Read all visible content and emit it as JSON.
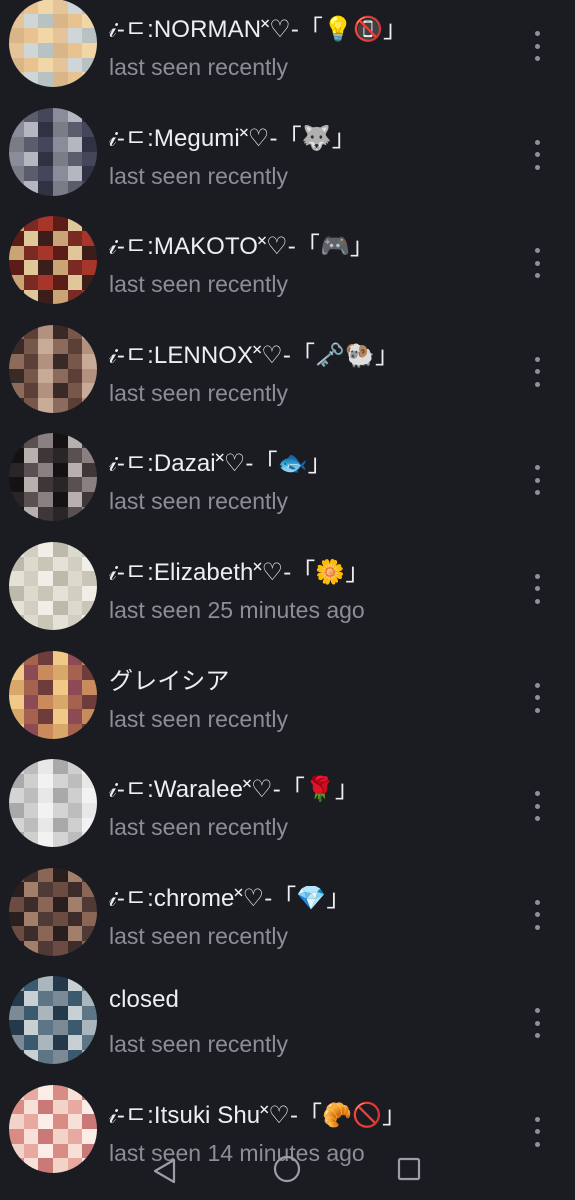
{
  "contacts": [
    {
      "name": "𝒾-ㄷ:NORMAN˟♡-「💡📵」",
      "status": "last seen recently",
      "avatar_colors": [
        "#d9b58a",
        "#e8c38f",
        "#f1d6a8",
        "#e6c49a",
        "#cfd6d8",
        "#b9c2c3"
      ]
    },
    {
      "name": "𝒾-ㄷ:Megumi˟♡-「🐺」",
      "status": "last seen recently",
      "avatar_colors": [
        "#7a7c86",
        "#5a5d6c",
        "#44475a",
        "#8a8c99",
        "#b4b6c0",
        "#2f3242"
      ]
    },
    {
      "name": "𝒾-ㄷ:MAKOTO˟♡-「🎮」",
      "status": "last seen recently",
      "avatar_colors": [
        "#c9a575",
        "#7a2a22",
        "#a6352a",
        "#5c1c18",
        "#e0c79a",
        "#3b1d1a"
      ]
    },
    {
      "name": "𝒾-ㄷ:LENNOX˟♡-「🗝️🐏」",
      "status": "last seen recently",
      "avatar_colors": [
        "#8c6b5d",
        "#5c4038",
        "#b2917f",
        "#3a2a27",
        "#76574a",
        "#c7ab98"
      ]
    },
    {
      "name": "𝒾-ㄷ:Dazai˟♡-「🐟」",
      "status": "last seen recently",
      "avatar_colors": [
        "#2a2627",
        "#5a5052",
        "#8a8081",
        "#141213",
        "#b8b0ae",
        "#3e3637"
      ]
    },
    {
      "name": "𝒾-ㄷ:Elizabeth˟♡-「🌼」",
      "status": "last seen 25 minutes ago",
      "avatar_colors": [
        "#e4e1d6",
        "#d2cfc2",
        "#f0eee6",
        "#bdb9ab",
        "#dcd9cd",
        "#c9c5b7"
      ]
    },
    {
      "name": "グレイシア",
      "status": "last seen recently",
      "avatar_colors": [
        "#d8a76a",
        "#a5624e",
        "#6e3c3a",
        "#f0c987",
        "#8c4a54",
        "#c98b5c"
      ]
    },
    {
      "name": "𝒾-ㄷ:Waralee˟♡-「🌹」",
      "status": "last seen recently",
      "avatar_colors": [
        "#d4d4d4",
        "#bdbdbd",
        "#e8e8e8",
        "#a9a9a9",
        "#cfcfcf",
        "#f2f2f2"
      ]
    },
    {
      "name": "𝒾-ㄷ:chrome˟♡-「💎」",
      "status": "last seen recently",
      "avatar_colors": [
        "#6b4b42",
        "#3d2c2a",
        "#8a6656",
        "#2a1f1f",
        "#a27f6b",
        "#4f3a35"
      ]
    },
    {
      "name": "closed",
      "status": "last seen recently",
      "avatar_colors": [
        "#7b8a94",
        "#3c5a6e",
        "#a9b6bd",
        "#24394a",
        "#c9d0d3",
        "#5d7584"
      ]
    },
    {
      "name": "𝒾-ㄷ:Itsuki Shu˟♡-「🥐🚫」",
      "status": "last seen 14 minutes ago",
      "avatar_colors": [
        "#f2d3c8",
        "#e8a9a0",
        "#fbece6",
        "#d98c86",
        "#f6e0d8",
        "#c97a78"
      ]
    }
  ],
  "navbar": {
    "back": "back-icon",
    "home": "home-icon",
    "recents": "recents-icon"
  }
}
